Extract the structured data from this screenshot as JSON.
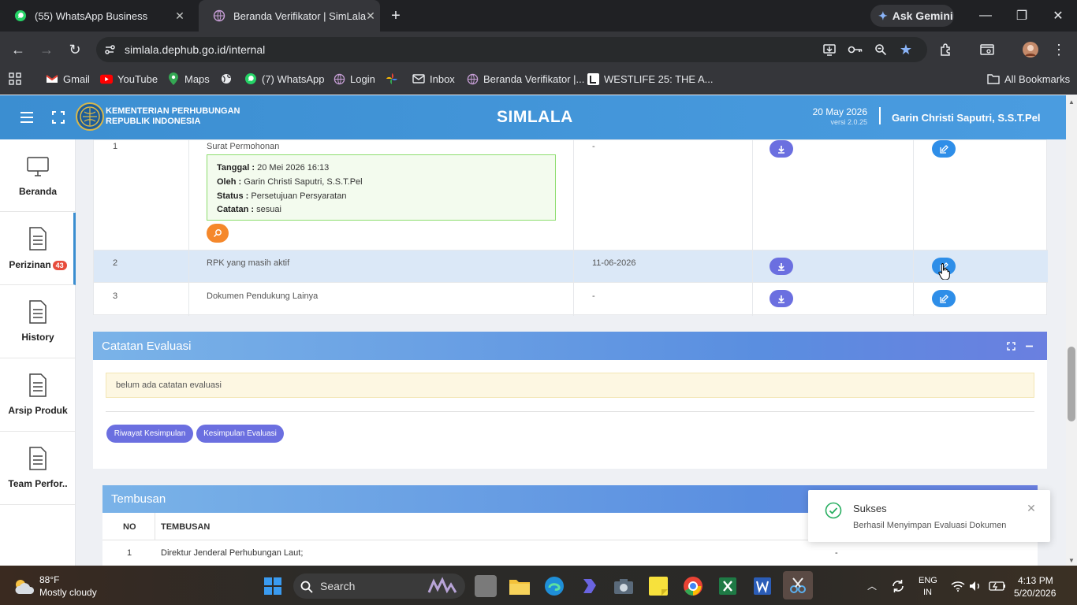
{
  "browser": {
    "tabs": [
      {
        "title": "(55) WhatsApp Business",
        "active": false
      },
      {
        "title": "Beranda Verifikator | SimLala",
        "active": true
      }
    ],
    "gemini_label": "Ask Gemini",
    "url": "simlala.dephub.go.id/internal",
    "bookmarks": [
      "Gmail",
      "YouTube",
      "Maps",
      "(7) WhatsApp",
      "Login",
      "Inbox",
      "Beranda Verifikator |...",
      "WESTLIFE 25: THE A..."
    ],
    "all_bookmarks": "All Bookmarks"
  },
  "header": {
    "ministry_line1": "KEMENTERIAN PERHUBUNGAN",
    "ministry_line2": "REPUBLIK INDONESIA",
    "app_name": "SIMLALA",
    "date": "20 May 2026",
    "version": "versi 2.0.25",
    "user": "Garin Christi Saputri, S.S.T.Pel"
  },
  "sidebar": {
    "items": [
      {
        "label": "Beranda",
        "icon": "monitor-icon"
      },
      {
        "label": "Perizinan",
        "badge": "43",
        "icon": "document-icon"
      },
      {
        "label": "History",
        "icon": "document-icon"
      },
      {
        "label": "Arsip Produk",
        "icon": "document-icon"
      },
      {
        "label": "Team Perfor..",
        "icon": "document-icon"
      }
    ]
  },
  "documents": {
    "rows": [
      {
        "no": "1",
        "name": "Surat Permohonan",
        "date": "-",
        "detail": {
          "tanggal_label": "Tanggal :",
          "tanggal": "20 Mei 2026 16:13",
          "oleh_label": "Oleh :",
          "oleh": "Garin Christi Saputri, S.S.T.Pel",
          "status_label": "Status :",
          "status": "Persetujuan Persyaratan",
          "catatan_label": "Catatan :",
          "catatan": "sesuai"
        }
      },
      {
        "no": "2",
        "name": "RPK yang masih aktif",
        "date": "11-06-2026"
      },
      {
        "no": "3",
        "name": "Dokumen Pendukung Lainya",
        "date": "-"
      }
    ]
  },
  "evaluasi": {
    "title": "Catatan Evaluasi",
    "note": "belum ada catatan evaluasi",
    "buttons": [
      "Riwayat Kesimpulan",
      "Kesimpulan Evaluasi"
    ]
  },
  "tembusan": {
    "title": "Tembusan",
    "columns": [
      "NO",
      "TEMBUSAN"
    ],
    "rows": [
      {
        "no": "1",
        "name": "Direktur Jenderal Perhubungan Laut;",
        "extra": "-"
      }
    ]
  },
  "toast": {
    "title": "Sukses",
    "message": "Berhasil Menyimpan Evaluasi Dokumen"
  },
  "taskbar": {
    "temperature": "88°F",
    "weather": "Mostly cloudy",
    "search_placeholder": "Search",
    "lang1": "ENG",
    "lang2": "IN",
    "time": "4:13 PM",
    "date": "5/20/2026"
  },
  "colors": {
    "header": "#4a9ce0",
    "download_button": "#6b6fe0",
    "edit_button": "#2e8ee8",
    "badge": "#e74c3c",
    "success": "#27ae60"
  }
}
